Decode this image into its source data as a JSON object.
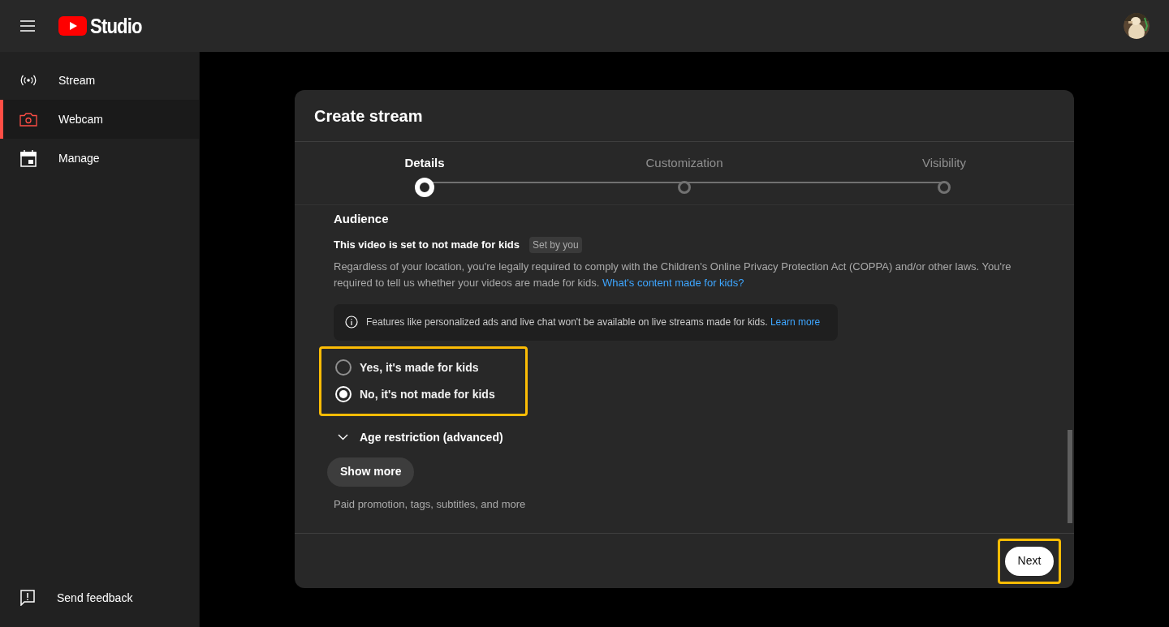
{
  "header": {
    "logo_text": "Studio"
  },
  "sidebar": {
    "items": [
      {
        "label": "Stream",
        "kind": "broadcast",
        "selected": false
      },
      {
        "label": "Webcam",
        "kind": "camera",
        "selected": true
      },
      {
        "label": "Manage",
        "kind": "calendar",
        "selected": false
      }
    ],
    "feedback": "Send feedback"
  },
  "dialog": {
    "title": "Create stream",
    "steps": [
      {
        "label": "Details",
        "selected": true
      },
      {
        "label": "Customization",
        "selected": false
      },
      {
        "label": "Visibility",
        "selected": false
      }
    ],
    "audience": {
      "heading": "Audience",
      "status": "This video is set to not made for kids",
      "status_badge": "Set by you",
      "description": "Regardless of your location, you're legally required to comply with the Children's Online Privacy Protection Act (COPPA) and/or other laws. You're required to tell us whether your videos are made for kids.",
      "description_link": "What's content made for kids?",
      "notice": "Features like personalized ads and live chat won't be available on live streams made for kids.",
      "notice_link": "Learn more",
      "options": [
        {
          "label": "Yes, it's made for kids",
          "selected": false
        },
        {
          "label": "No, it's not made for kids",
          "selected": true
        }
      ]
    },
    "age_restriction": {
      "label": "Age restriction (advanced)",
      "expanded": false
    },
    "show_more": {
      "label": "Show more",
      "hint": "Paid promotion, tags, subtitles, and more"
    },
    "next_button": "Next"
  }
}
